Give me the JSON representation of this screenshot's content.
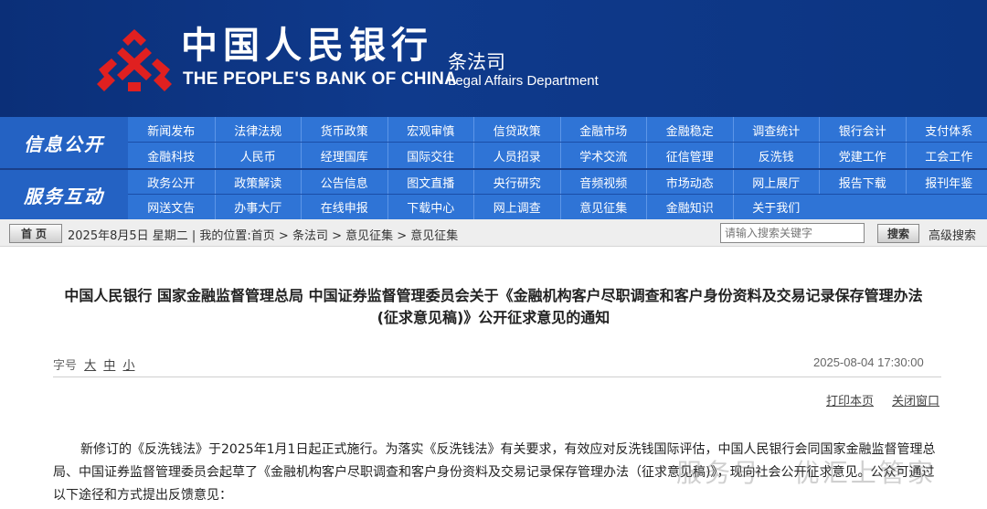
{
  "header": {
    "cn_name": "中国人民银行",
    "en_name": "THE PEOPLE'S BANK OF CHINA",
    "dept_cn": "条法司",
    "dept_en": "Legal Affairs Department",
    "logo_color": "#e02020",
    "banner_color": "#0f3a8c"
  },
  "nav": {
    "group1_label": "信息公开",
    "group2_label": "服务互动",
    "row1": [
      "新闻发布",
      "法律法规",
      "货币政策",
      "宏观审慎",
      "信贷政策",
      "金融市场",
      "金融稳定",
      "调查统计",
      "银行会计",
      "支付体系"
    ],
    "row2": [
      "金融科技",
      "人民币",
      "经理国库",
      "国际交往",
      "人员招录",
      "学术交流",
      "征信管理",
      "反洗钱",
      "党建工作",
      "工会工作"
    ],
    "row3": [
      "政务公开",
      "政策解读",
      "公告信息",
      "图文直播",
      "央行研究",
      "音频视频",
      "市场动态",
      "网上展厅",
      "报告下载",
      "报刊年鉴"
    ],
    "row4": [
      "网送文告",
      "办事大厅",
      "在线申报",
      "下载中心",
      "网上调查",
      "意见征集",
      "金融知识",
      "关于我们"
    ]
  },
  "breadcrumb": {
    "home": "首页",
    "text": "2025年8月5日 星期二 | 我的位置:首页 > 条法司 > 意见征集 > 意见征集",
    "search_placeholder": "请输入搜索关键字",
    "search_button": "搜索",
    "advanced": "高级搜索"
  },
  "article": {
    "title_line1": "中国人民银行 国家金融监督管理总局 中国证券监督管理委员会关于《金融机构客户尽职调查和客户身份资料及交易记录保存管理办法",
    "title_line2": "(征求意见稿)》公开征求意见的通知",
    "font_label": "字号",
    "size_large": "大",
    "size_medium": "中",
    "size_small": "小",
    "date": "2025-08-04 17:30:00",
    "print": "打印本页",
    "close": "关闭窗口",
    "body": "新修订的《反洗钱法》于2025年1月1日起正式施行。为落实《反洗钱法》有关要求，有效应对反洗钱国际评估，中国人民银行会同国家金融监督管理总局、中国证券监督管理委员会起草了《金融机构客户尽职调查和客户身份资料及交易记录保存管理办法（征求意见稿)》，现向社会公开征求意见。公众可通过以下途径和方式提出反馈意见："
  },
  "watermark": "服务号 · 优汇上管家"
}
